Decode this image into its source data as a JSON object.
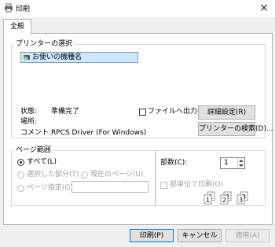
{
  "window": {
    "title": "印刷",
    "close_glyph": "×"
  },
  "tabs": [
    {
      "label": "全般"
    }
  ],
  "printer_group": {
    "legend": "プリンターの選択",
    "selected_printer": "お使いの機種名",
    "status_label": "状態:",
    "status_value": "準備完了",
    "location_label": "場所:",
    "location_value": "",
    "comment_label": "コメント:",
    "comment_value": "RPCS Driver (For Windows)",
    "print_to_file_label": "ファイルへ出力(F)",
    "preferences_button": "詳細設定(R)",
    "find_printer_button": "プリンターの検索(D)..."
  },
  "page_range": {
    "legend": "ページ範囲",
    "all_label": "すべて(L)",
    "selection_label": "選択した部分(T)",
    "current_page_label": "現在のページ(U)",
    "pages_label": "ページ指定(G):",
    "pages_value": ""
  },
  "copies": {
    "label": "部数(C):",
    "value": "1",
    "collate_label": "部単位で印刷(O)",
    "collate_pages": [
      "1",
      "1",
      "2",
      "2",
      "3",
      "3"
    ]
  },
  "buttons": {
    "print": "印刷(P)",
    "cancel": "キャンセル",
    "apply": "適用(A)"
  }
}
